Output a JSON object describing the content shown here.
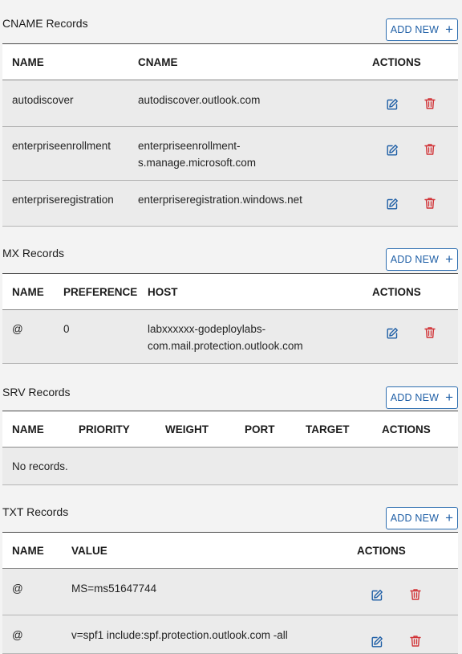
{
  "cname": {
    "title": "CNAME Records",
    "add_label": "ADD NEW",
    "headers": {
      "name": "NAME",
      "cname": "CNAME",
      "actions": "ACTIONS"
    },
    "rows": [
      {
        "name": "autodiscover",
        "cname": "autodiscover.outlook.com"
      },
      {
        "name": "enterpriseenrollment",
        "cname_line1": "enterpriseenrollment-",
        "cname_line2": "s.manage.microsoft.com"
      },
      {
        "name": "enterpriseregistration",
        "cname": "enterpriseregistration.windows.net"
      }
    ]
  },
  "mx": {
    "title": "MX Records",
    "add_label": "ADD NEW",
    "headers": {
      "name": "NAME",
      "preference": "PREFERENCE",
      "host": "HOST",
      "actions": "ACTIONS"
    },
    "rows": [
      {
        "name": "@",
        "preference": "0",
        "host_line1": "labxxxxxx-godeploylabs-",
        "host_line2": "com.mail.protection.outlook.com"
      }
    ]
  },
  "srv": {
    "title": "SRV Records",
    "add_label": "ADD NEW",
    "headers": {
      "name": "NAME",
      "priority": "PRIORITY",
      "weight": "WEIGHT",
      "port": "PORT",
      "target": "TARGET",
      "actions": "ACTIONS"
    },
    "empty": "No records."
  },
  "txt": {
    "title": "TXT Records",
    "add_label": "ADD NEW",
    "headers": {
      "name": "NAME",
      "value": "VALUE",
      "actions": "ACTIONS"
    },
    "rows": [
      {
        "name": "@",
        "value": "MS=ms51647744"
      },
      {
        "name": "@",
        "value": "v=spf1 include:spf.protection.outlook.com -all"
      }
    ]
  },
  "colors": {
    "accent": "#1f5fa6",
    "delete": "#d13438",
    "row_bg": "#ebebeb"
  },
  "icons": {
    "edit": "edit-icon",
    "delete": "trash-icon",
    "add": "plus-icon"
  }
}
